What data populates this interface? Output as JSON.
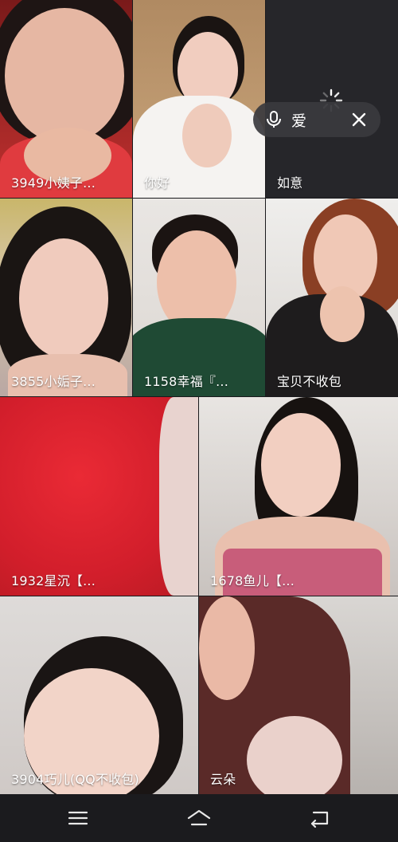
{
  "tiles": [
    {
      "label": "3949小姨子..."
    },
    {
      "label": "你好"
    },
    {
      "label": "如意"
    },
    {
      "label": "3855小姤子..."
    },
    {
      "label": "1158幸福『..."
    },
    {
      "label": "宝贝不收包"
    },
    {
      "label": "1932星沉【..."
    },
    {
      "label": "1678鱼儿【..."
    },
    {
      "label": "3904巧儿(QQ不收包)"
    },
    {
      "label": "云朵"
    }
  ],
  "voice": {
    "word": "爱"
  },
  "navbar": {
    "menu_icon": "menu-icon",
    "home_icon": "home-icon",
    "back_icon": "back-icon"
  },
  "colors": {
    "background": "#1a1a1d",
    "pill": "#3a3a3e",
    "label": "#ffffff"
  }
}
